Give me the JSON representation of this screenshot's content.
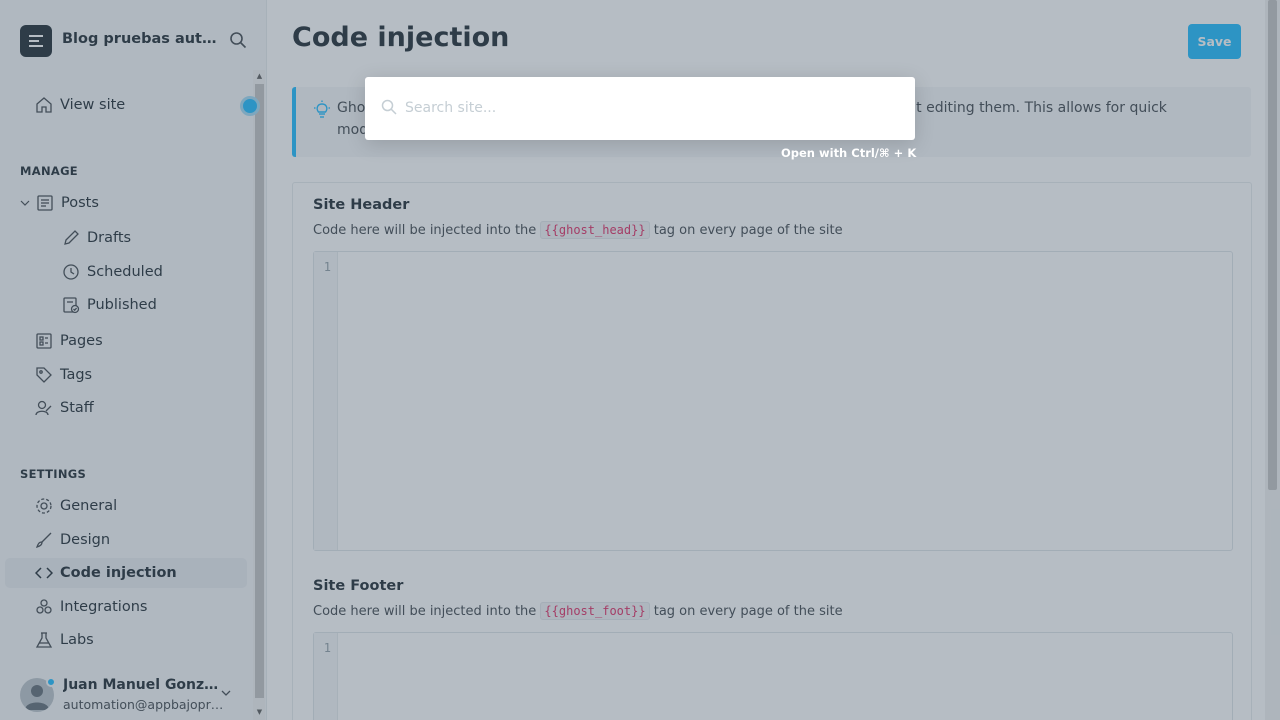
{
  "sidebar": {
    "blog_title": "Blog pruebas automatizadas",
    "view_site": "View site",
    "manage_title": "MANAGE",
    "manage_items": [
      {
        "label": "Posts",
        "icon": "posts-icon"
      },
      {
        "label": "Drafts",
        "icon": "pencil-icon"
      },
      {
        "label": "Scheduled",
        "icon": "clock-icon"
      },
      {
        "label": "Published",
        "icon": "published-icon"
      },
      {
        "label": "Pages",
        "icon": "pages-icon"
      },
      {
        "label": "Tags",
        "icon": "tag-icon"
      },
      {
        "label": "Staff",
        "icon": "staff-icon"
      }
    ],
    "settings_title": "SETTINGS",
    "settings_items": [
      {
        "label": "General",
        "icon": "gear-icon"
      },
      {
        "label": "Design",
        "icon": "brush-icon"
      },
      {
        "label": "Code injection",
        "icon": "code-icon",
        "active": true
      },
      {
        "label": "Integrations",
        "icon": "integrations-icon"
      },
      {
        "label": "Labs",
        "icon": "flask-icon"
      }
    ],
    "user": {
      "name": "Juan Manuel González",
      "email": "automation@appbajopruebas.com"
    }
  },
  "main": {
    "title": "Code injection",
    "save_label": "Save",
    "notice": "Ghost allows you to inject code into the top and bottom of your theme files without editing them. This allows for quick modifications to insert useful things like tracking codes and meta tags.",
    "header": {
      "title": "Site Header",
      "desc_before": "Code here will be injected into the",
      "tag": "{{ghost_head}}",
      "desc_after": "tag on every page of the site",
      "line_number": "1"
    },
    "footer": {
      "title": "Site Footer",
      "desc_before": "Code here will be injected into the",
      "tag": "{{ghost_foot}}",
      "desc_after": "tag on every page of the site",
      "line_number": "1"
    }
  },
  "search_modal": {
    "placeholder": "Search site...",
    "hint": "Open with Ctrl/⌘ + K"
  },
  "colors": {
    "accent": "#14b8ff",
    "text": "#15212a",
    "code_tag": "#e0245e",
    "sidebar_bg": "#f5f7f8"
  }
}
